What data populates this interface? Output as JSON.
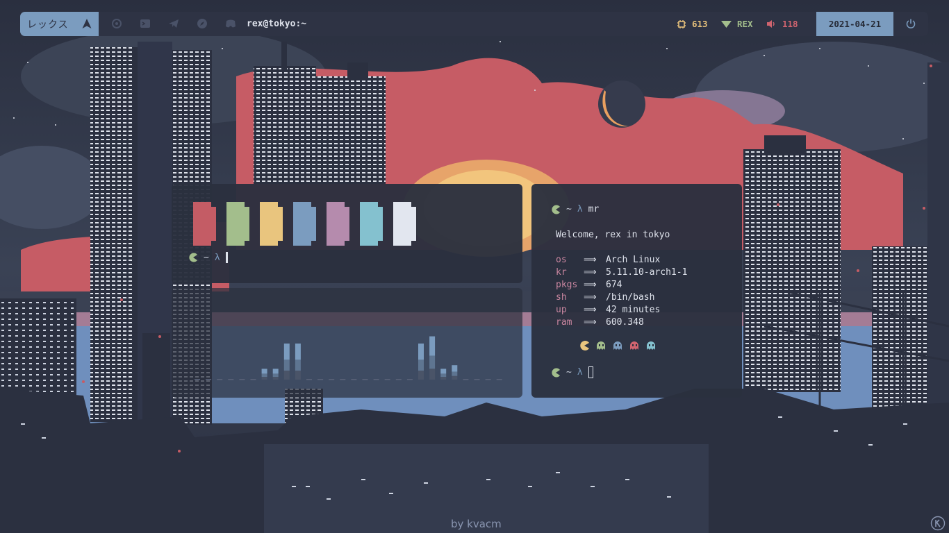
{
  "topbar": {
    "workspace_label": "レックス",
    "window_title": "rex@tokyo:~",
    "cpu": {
      "value": "613",
      "color": "#e5c07b"
    },
    "user": {
      "value": "REX",
      "color": "#a3be8c"
    },
    "volume": {
      "value": "118",
      "color": "#d0646f"
    },
    "date": "2021-04-21",
    "apps": [
      "settings-icon",
      "terminal-icon",
      "telegram-icon",
      "browser-icon",
      "discord-icon"
    ]
  },
  "colors": {
    "palette": [
      "#c45c65",
      "#a3be8c",
      "#e9c57e",
      "#7b9cbf",
      "#b58bad",
      "#84c1cf",
      "#e2e6ef"
    ],
    "accent": "#7b9cbf",
    "pacman": "#a3be8c",
    "pacman_yellow": "#e9c57e"
  },
  "terminal_colors": {
    "prompt": {
      "tilde": "~",
      "lambda": "λ"
    }
  },
  "terminal_visualizer": {
    "bars": [
      0,
      0,
      0,
      0,
      0,
      0,
      0.3,
      0.3,
      1,
      1,
      0,
      0,
      0,
      0,
      0,
      0,
      0,
      0,
      0,
      0,
      1,
      1.2,
      0.3,
      0.4,
      0,
      0,
      0,
      0
    ]
  },
  "terminal_fetch": {
    "prompt": {
      "tilde": "~",
      "lambda": "λ",
      "command": "mr"
    },
    "welcome": "Welcome, rex in tokyo",
    "arrow": "⟹",
    "rows": [
      {
        "key": "os",
        "value": "Arch Linux"
      },
      {
        "key": "kr",
        "value": "5.11.10-arch1-1"
      },
      {
        "key": "pkgs",
        "value": "674"
      },
      {
        "key": "sh",
        "value": "/bin/bash"
      },
      {
        "key": "up",
        "value": "42 minutes"
      },
      {
        "key": "ram",
        "value": "600.348"
      }
    ],
    "ghost_colors": [
      "#e9c57e",
      "#a3be8c",
      "#7b9cbf",
      "#d0646f",
      "#84c1cf"
    ],
    "prompt2": {
      "tilde": "~",
      "lambda": "λ"
    }
  },
  "wallpaper": {
    "credit": "by kvacm"
  }
}
